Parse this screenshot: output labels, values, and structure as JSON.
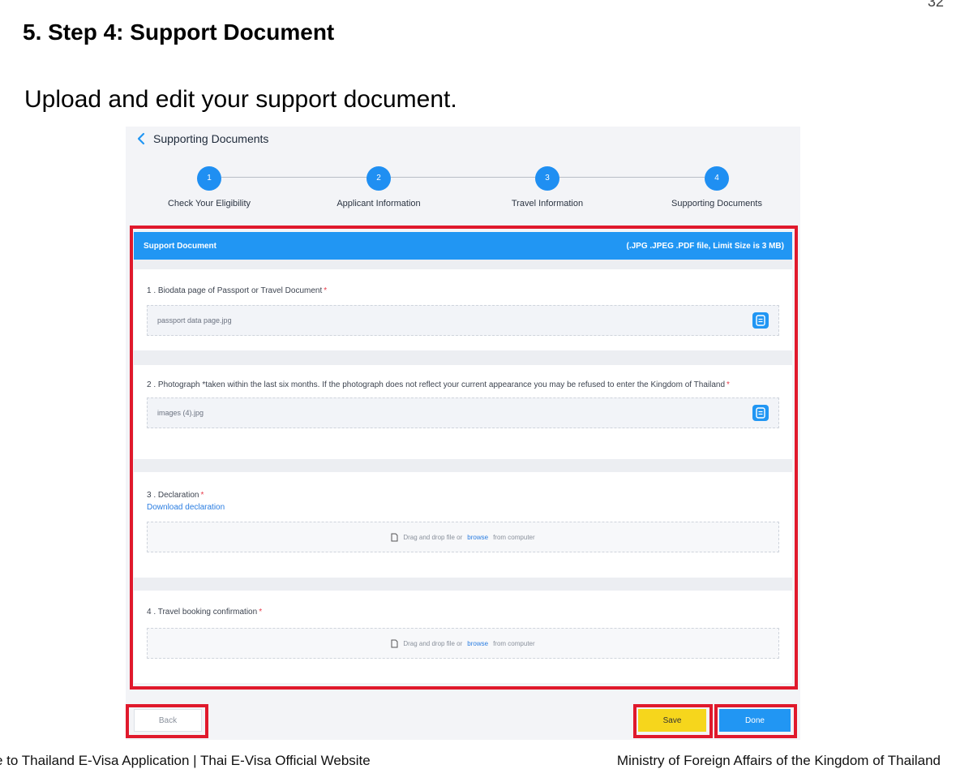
{
  "document": {
    "page_number": "32",
    "heading": "5. Step 4: Support Document",
    "intro": "Upload and edit your support document.",
    "footer_left": "e to Thailand E-Visa Application | Thai E-Visa Official Website",
    "footer_right": "Ministry of Foreign Affairs of the Kingdom of Thailand"
  },
  "app": {
    "page_title": "Supporting Documents",
    "steps": [
      {
        "number": "1",
        "label": "Check Your Eligibility"
      },
      {
        "number": "2",
        "label": "Applicant Information"
      },
      {
        "number": "3",
        "label": "Travel Information"
      },
      {
        "number": "4",
        "label": "Supporting Documents"
      }
    ],
    "card": {
      "title": "Support Document",
      "file_hint": "(.JPG .JPEG .PDF file, Limit Size is 3 MB)"
    },
    "items": [
      {
        "label": "1 . Biodata page of Passport or Travel Document",
        "required_mark": "*",
        "file_name": "passport data page.jpg"
      },
      {
        "label": "2 . Photograph *taken within the last six months. If the photograph does not reflect your current appearance you may be refused to enter the Kingdom of Thailand",
        "required_mark": "*",
        "file_name": "images (4).jpg"
      },
      {
        "label": "3 . Declaration",
        "required_mark": "*",
        "link": "Download declaration"
      },
      {
        "label": "4 . Travel booking confirmation",
        "required_mark": "*"
      }
    ],
    "dropzone": {
      "before": "Drag and drop file or",
      "link": "browse",
      "after": "from computer"
    },
    "buttons": {
      "back": "Back",
      "save": "Save",
      "done": "Done"
    }
  },
  "colors": {
    "accent": "#2196f3",
    "highlight_frame": "#e0192c",
    "save": "#f6d61c",
    "required": "#e83b4a"
  }
}
